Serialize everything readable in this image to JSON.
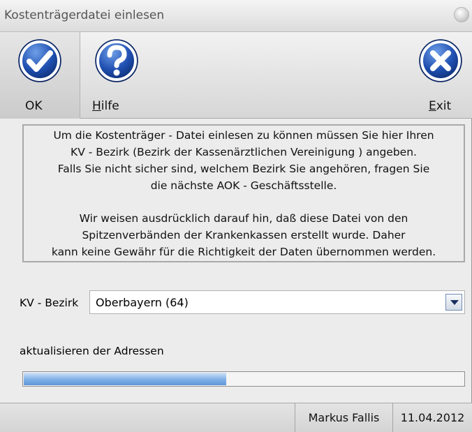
{
  "window": {
    "title": "Kostenträgerdatei einlesen"
  },
  "toolbar": {
    "ok_label": "OK",
    "help_accel": "H",
    "help_rest": "ilfe",
    "exit_accel": "E",
    "exit_rest": "xit"
  },
  "info": {
    "lines": [
      "Um die Kostenträger - Datei einlesen zu können müssen Sie hier Ihren",
      "KV - Bezirk (Bezirk der Kassenärztlichen Vereinigung ) angeben.",
      "Falls Sie nicht sicher sind, welchem Bezirk Sie angehören, fragen Sie",
      "die nächste AOK - Geschäftsstelle.",
      "Wir weisen ausdrücklich darauf hin, daß diese Datei von den",
      "Spitzenverbänden der Krankenkassen erstellt wurde. Daher",
      "kann keine Gewähr für die Richtigkeit der Daten übernommen werden."
    ]
  },
  "kv": {
    "label": "KV - Bezirk",
    "selected": "Oberbayern (64)"
  },
  "progress": {
    "label": "aktualisieren der Adressen",
    "fraction": 0.46
  },
  "status": {
    "user": "Markus Fallis",
    "date": "11.04.2012"
  },
  "colors": {
    "icon_blue": "#1f4fb0",
    "progress_blue": "#6ea4e0"
  },
  "icons": {
    "ok": "checkmark-icon",
    "help": "question-icon",
    "exit": "close-icon"
  }
}
